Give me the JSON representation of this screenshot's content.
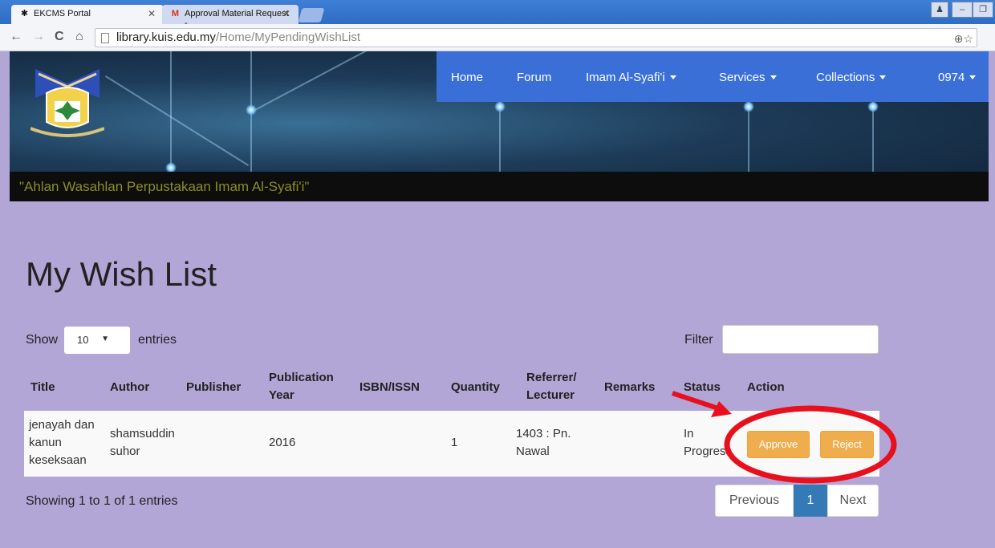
{
  "browser": {
    "tabs": [
      {
        "title": "EKCMS Portal",
        "active": true
      },
      {
        "title": "Approval Material Request -",
        "active": false
      }
    ],
    "url_host": "library.kuis.edu.my",
    "url_path": "/Home/MyPendingWishList"
  },
  "nav": {
    "items": [
      "Home",
      "Forum",
      "Imam Al-Syafi'i",
      "Services",
      "Collections",
      "0974"
    ]
  },
  "marquee": "\"Ahlan Wasahlan Perpustakaan Imam Al-Syafi'i\"",
  "page": {
    "title": "My Wish List",
    "show_label": "Show",
    "page_length": "10",
    "entries_label": "entries",
    "filter_label": "Filter",
    "filter_value": ""
  },
  "table": {
    "headers": {
      "title": "Title",
      "author": "Author",
      "publisher": "Publisher",
      "pub_year_1": "Publication",
      "pub_year_2": "Year",
      "isbn": "ISBN/ISSN",
      "quantity": "Quantity",
      "referrer_1": "Referrer/",
      "referrer_2": "Lecturer",
      "remarks": "Remarks",
      "status": "Status",
      "action": "Action"
    },
    "rows": [
      {
        "title_lines": [
          "jenayah dan",
          "kanun",
          "keseksaan"
        ],
        "author_lines": [
          "shamsuddin",
          "suhor"
        ],
        "publisher": "",
        "year": "2016",
        "isbn": "",
        "quantity": "1",
        "referrer_lines": [
          "1403 : Pn.",
          "Nawal"
        ],
        "remarks": "",
        "status_lines": [
          "In",
          "Progress"
        ],
        "approve_label": "Approve",
        "reject_label": "Reject"
      }
    ]
  },
  "footer": {
    "info": "Showing 1 to 1 of 1 entries",
    "previous": "Previous",
    "current_page": "1",
    "next": "Next"
  },
  "colors": {
    "content_bg": "#b2a6d6",
    "nav_bg": "#3a6fd8",
    "button_warning": "#f0ad4e",
    "pager_active": "#337ab7",
    "annotation_red": "#e8101c"
  }
}
